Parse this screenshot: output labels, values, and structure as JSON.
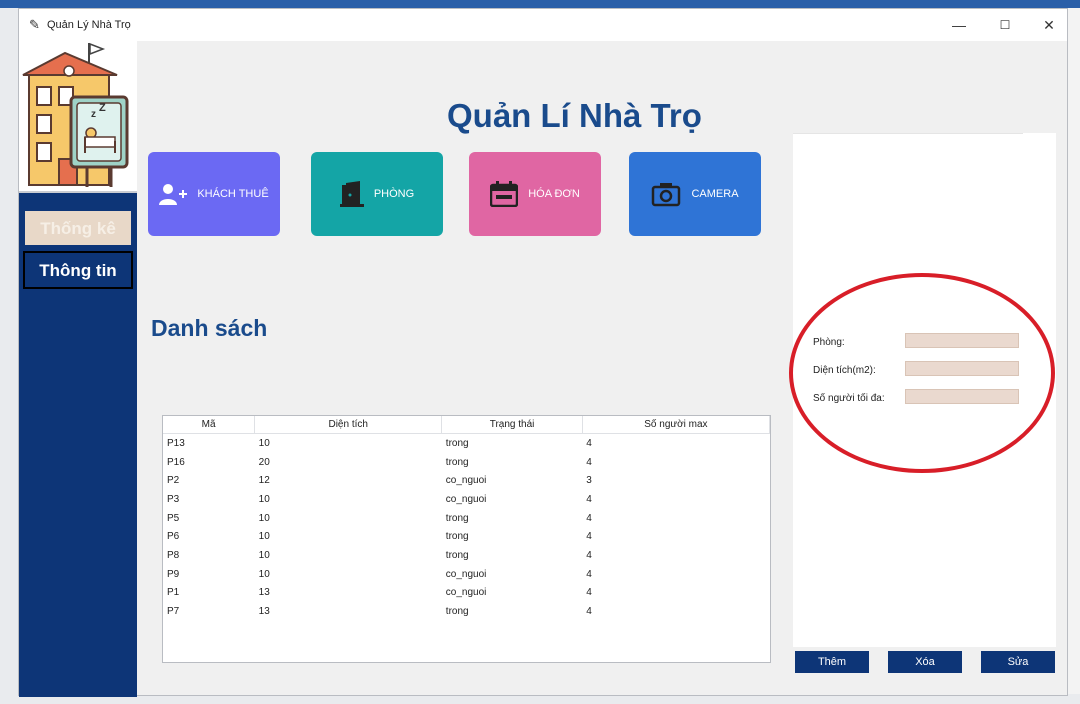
{
  "window": {
    "title": "Quản Lý Nhà Trọ",
    "controls": {
      "minimize": "—",
      "maximize": "☐",
      "close": "✕"
    }
  },
  "header": {
    "title": "Quản Lí Nhà Trọ"
  },
  "sidebar": {
    "stats_label": "Thống kê",
    "info_label": "Thông tin"
  },
  "tiles": [
    {
      "label": "KHÁCH THUÊ",
      "icon": "add-user-icon",
      "color": "#6b69f3"
    },
    {
      "label": "PHÒNG",
      "icon": "door-icon",
      "color": "#14a5a6"
    },
    {
      "label": "HÓA ĐƠN",
      "icon": "calendar-icon",
      "color": "#e066a3"
    },
    {
      "label": "CAMERA",
      "icon": "camera-icon",
      "color": "#2f74d6"
    }
  ],
  "list": {
    "title": "Danh sách",
    "columns": [
      "Mã",
      "Diện tích",
      "Trạng thái",
      "Số người max"
    ],
    "rows": [
      [
        "P13",
        "10",
        "trong",
        "4"
      ],
      [
        "P16",
        "20",
        "trong",
        "4"
      ],
      [
        "P2",
        "12",
        "co_nguoi",
        "3"
      ],
      [
        "P3",
        "10",
        "co_nguoi",
        "4"
      ],
      [
        "P5",
        "10",
        "trong",
        "4"
      ],
      [
        "P6",
        "10",
        "trong",
        "4"
      ],
      [
        "P8",
        "10",
        "trong",
        "4"
      ],
      [
        "P9",
        "10",
        "co_nguoi",
        "4"
      ],
      [
        "P1",
        "13",
        "co_nguoi",
        "4"
      ],
      [
        "P7",
        "13",
        "trong",
        "4"
      ]
    ]
  },
  "form": {
    "room_label": "Phòng:",
    "room_value": "",
    "area_label": "Diện tích(m2):",
    "area_value": "",
    "max_label": "Số người tối đa:",
    "max_value": ""
  },
  "actions": {
    "add": "Thêm",
    "delete": "Xóa",
    "edit": "Sửa"
  },
  "colors": {
    "sidebar": "#0d3577",
    "title": "#1a4b8c",
    "highlight_oval": "#d81e28"
  }
}
